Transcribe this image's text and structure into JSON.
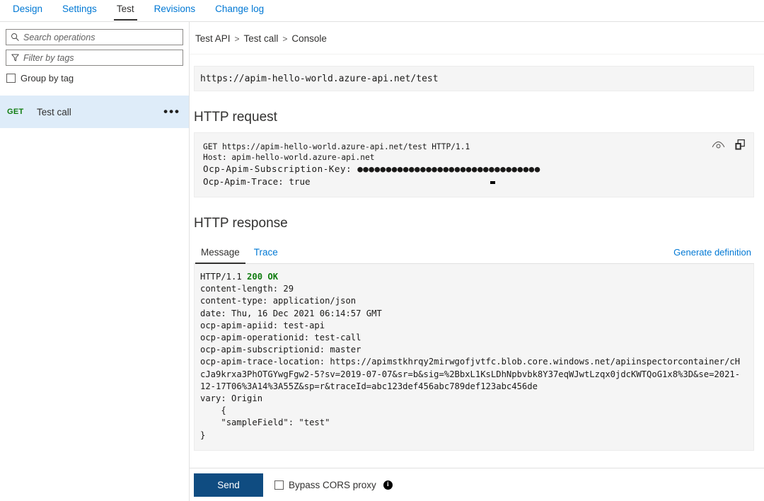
{
  "top_tabs": [
    {
      "label": "Design",
      "active": false
    },
    {
      "label": "Settings",
      "active": false
    },
    {
      "label": "Test",
      "active": true
    },
    {
      "label": "Revisions",
      "active": false
    },
    {
      "label": "Change log",
      "active": false
    }
  ],
  "sidebar": {
    "search_placeholder": "Search operations",
    "search_value": "",
    "filter_placeholder": "Filter by tags",
    "filter_value": "",
    "group_by_tag_label": "Group by tag",
    "group_by_tag_checked": false,
    "operations": [
      {
        "verb": "GET",
        "name": "Test call",
        "menu": "•••",
        "selected": true
      }
    ]
  },
  "breadcrumb": {
    "items": [
      "Test API",
      "Test call",
      "Console"
    ],
    "separator": ">"
  },
  "console": {
    "request_url": "https://apim-hello-world.azure-api.net/test",
    "http_request_title": "HTTP request",
    "request_lines_small": [
      "GET https://apim-hello-world.azure-api.net/test HTTP/1.1",
      "Host: apim-hello-world.azure-api.net"
    ],
    "request_lines_big": [
      "Ocp-Apim-Subscription-Key: ●●●●●●●●●●●●●●●●●●●●●●●●●●●●●●●●",
      "Ocp-Apim-Trace: true"
    ],
    "reveal_icon": "eye-icon",
    "copy_icon": "copy-icon",
    "http_response_title": "HTTP response",
    "response_tabs": [
      {
        "label": "Message",
        "active": true
      },
      {
        "label": "Trace",
        "active": false
      }
    ],
    "generate_definition_label": "Generate definition",
    "response": {
      "status_prefix": "HTTP/1.1 ",
      "status_code": "200 OK",
      "headers": [
        "content-length: 29",
        "content-type: application/json",
        "date: Thu, 16 Dec 2021 06:14:57 GMT",
        "ocp-apim-apiid: test-api",
        "ocp-apim-operationid: test-call",
        "ocp-apim-subscriptionid: master"
      ],
      "trace_location": "ocp-apim-trace-location: https://apimstkhrqy2mirwgofjvtfc.blob.core.windows.net/apiinspectorcontainer/cHcJa9krxa3PhOTGYwgFgw2-5?sv=2019-07-07&sr=b&sig=%2BbxL1KsLDhNpbvbk8Y37eqWJwtLzqx0jdcKWTQoG1x8%3D&se=2021-12-17T06%3A14%3A55Z&sp=r&traceId=abc123def456abc789def123abc456de",
      "trailing_headers": [
        "vary: Origin"
      ],
      "body_lines": [
        "    {",
        "    \"sampleField\": \"test\"",
        "}"
      ]
    }
  },
  "footer": {
    "send_label": "Send",
    "bypass_label": "Bypass CORS proxy",
    "bypass_checked": false,
    "info_icon_char": "i"
  },
  "colors": {
    "link": "#0078d4",
    "verb_get": "#107c10",
    "selected_row": "#deecf9",
    "send_button": "#0f4c81",
    "status_ok": "#107c10"
  }
}
